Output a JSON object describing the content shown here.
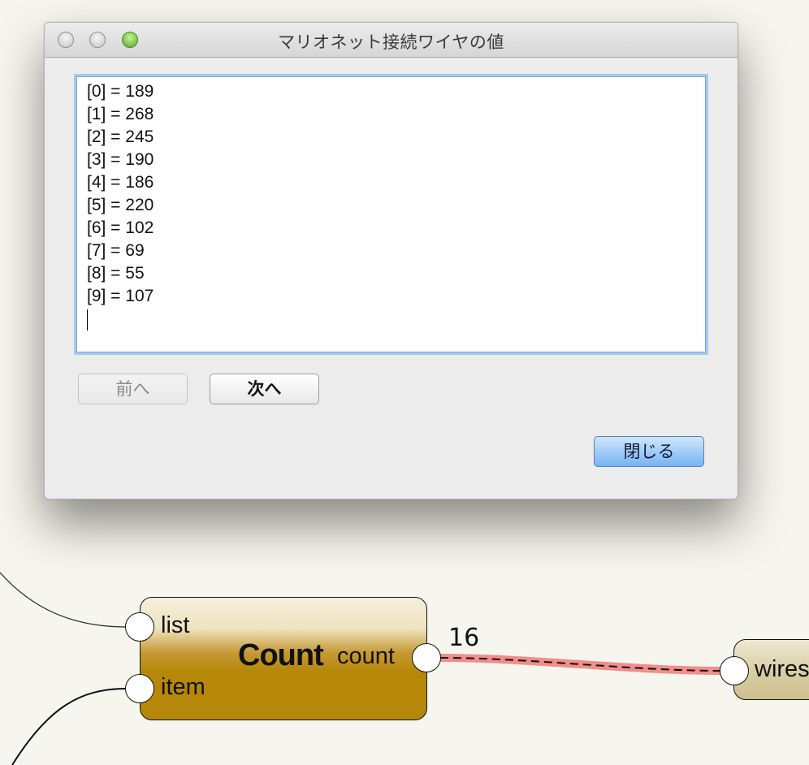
{
  "dialog": {
    "title": "マリオネット接続ワイヤの値",
    "values": [
      "[0] = 189",
      "[1] = 268",
      "[2] = 245",
      "[3] = 190",
      "[4] = 186",
      "[5] = 220",
      "[6] = 102",
      "[7] = 69",
      "[8] = 55",
      "[9] = 107"
    ],
    "prev_label": "前へ",
    "next_label": "次へ",
    "close_label": "閉じる"
  },
  "canvas": {
    "count_node": {
      "title": "Count",
      "inputs": [
        "list",
        "item"
      ],
      "output": "count",
      "output_value": "16"
    },
    "wires_node": {
      "input_label": "wires"
    },
    "colors": {
      "node_fill": "#b6880a",
      "selected_wire": "#e65a5a",
      "primary_button": "#76b3f1"
    }
  }
}
